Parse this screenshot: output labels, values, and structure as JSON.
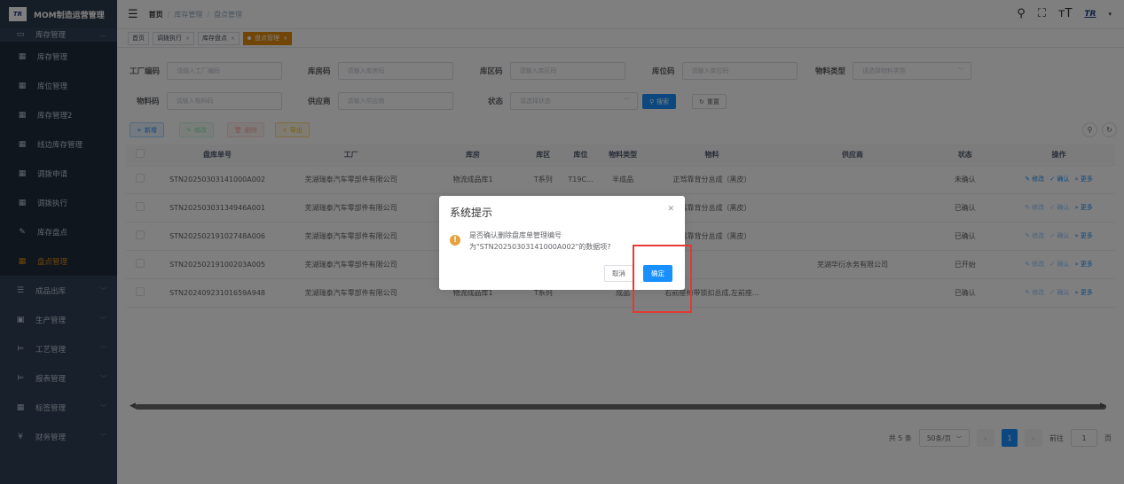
{
  "app": {
    "title": "MOM制造运营管理",
    "logo": "TR"
  },
  "sidebar": {
    "parent": {
      "label": "库存管理"
    },
    "items": [
      {
        "label": "库存管理"
      },
      {
        "label": "库位管理"
      },
      {
        "label": "库存管理2"
      },
      {
        "label": "线边库存管理"
      },
      {
        "label": "调拨申请"
      },
      {
        "label": "调拨执行"
      },
      {
        "label": "库存盘点"
      },
      {
        "label": "盘点管理"
      }
    ],
    "groups": [
      {
        "label": "成品出库"
      },
      {
        "label": "生产管理"
      },
      {
        "label": "工艺管理"
      },
      {
        "label": "报表管理"
      },
      {
        "label": "标签管理"
      },
      {
        "label": "财务管理"
      }
    ]
  },
  "breadcrumb": {
    "home": "首页",
    "b1": "库存管理",
    "b2": "盘点管理",
    "sep": "/"
  },
  "tags": [
    {
      "label": "首页"
    },
    {
      "label": "调拨执行"
    },
    {
      "label": "库存盘点"
    },
    {
      "label": "盘点管理"
    }
  ],
  "search": {
    "factory_code": {
      "label": "工厂编码",
      "placeholder": "请输入工厂编码"
    },
    "warehouse": {
      "label": "库房码",
      "placeholder": "请输入库房码"
    },
    "area": {
      "label": "库区码",
      "placeholder": "请输入库区码"
    },
    "location": {
      "label": "库位码",
      "placeholder": "请输入库位码"
    },
    "material_type": {
      "label": "物料类型",
      "placeholder": "请选择物料类型"
    },
    "material_code": {
      "label": "物料码",
      "placeholder": "请输入物料码"
    },
    "supplier": {
      "label": "供应商",
      "placeholder": "请输入供应商"
    },
    "status": {
      "label": "状态",
      "placeholder": "请选择状态"
    },
    "search_btn": "搜索",
    "reset_btn": "重置"
  },
  "toolbar": {
    "add": "新增",
    "edit": "修改",
    "delete": "删除",
    "export": "导出"
  },
  "table": {
    "headers": [
      "盘库单号",
      "工厂",
      "库房",
      "库区",
      "库位",
      "物料类型",
      "物料",
      "供应商",
      "状态",
      "操作"
    ],
    "rows": [
      {
        "no": "STN20250303141000A002",
        "factory": "芜湖瑞泰汽车零部件有限公司",
        "warehouse": "物流成品库1",
        "area": "T系列",
        "loc": "T19C...",
        "mtype": "半成品",
        "material": "正驾靠背分总成（黑皮）",
        "supplier": "",
        "status": "未确认"
      },
      {
        "no": "STN20250303134946A001",
        "factory": "芜湖瑞泰汽车零部件有限公司",
        "warehouse": "",
        "area": "",
        "loc": "",
        "mtype": "",
        "material": "正驾靠背分总成（黑皮）",
        "supplier": "",
        "status": "已确认"
      },
      {
        "no": "STN20250219102748A006",
        "factory": "芜湖瑞泰汽车零部件有限公司",
        "warehouse": "",
        "area": "",
        "loc": "",
        "mtype": "",
        "material": "正驾靠背分总成（黑皮）",
        "supplier": "",
        "status": "已确认"
      },
      {
        "no": "STN20250219100203A005",
        "factory": "芜湖瑞泰汽车零部件有限公司",
        "warehouse": "",
        "area": "",
        "loc": "",
        "mtype": "",
        "material": "",
        "supplier": "芜湖华衍水务有限公司",
        "status": "已开始"
      },
      {
        "no": "STN20240923101659A948",
        "factory": "芜湖瑞泰汽车零部件有限公司",
        "warehouse": "物流成品库1",
        "area": "T系列",
        "loc": "",
        "mtype": "成品",
        "material": "右前座椅带锁扣总成,左前座...",
        "supplier": "",
        "status": "已确认"
      }
    ],
    "ops": {
      "edit": "修改",
      "confirm": "确认",
      "more": "更多"
    }
  },
  "pagination": {
    "total": "共 5 条",
    "page_size": "50条/页",
    "current": "1",
    "goto": "前往",
    "goto_value": "1",
    "page_unit": "页"
  },
  "dialog": {
    "title": "系统提示",
    "line1": "是否确认删除盘库单管理编号",
    "line2": "为\"STN20250303141000A002\"的数据项?",
    "cancel": "取消",
    "ok": "确定"
  },
  "colors": {
    "sidebar_bg": "#304156",
    "active": "#e08a0a",
    "primary": "#1890ff",
    "warning": "#e6a23c",
    "highlight": "#e53935"
  }
}
